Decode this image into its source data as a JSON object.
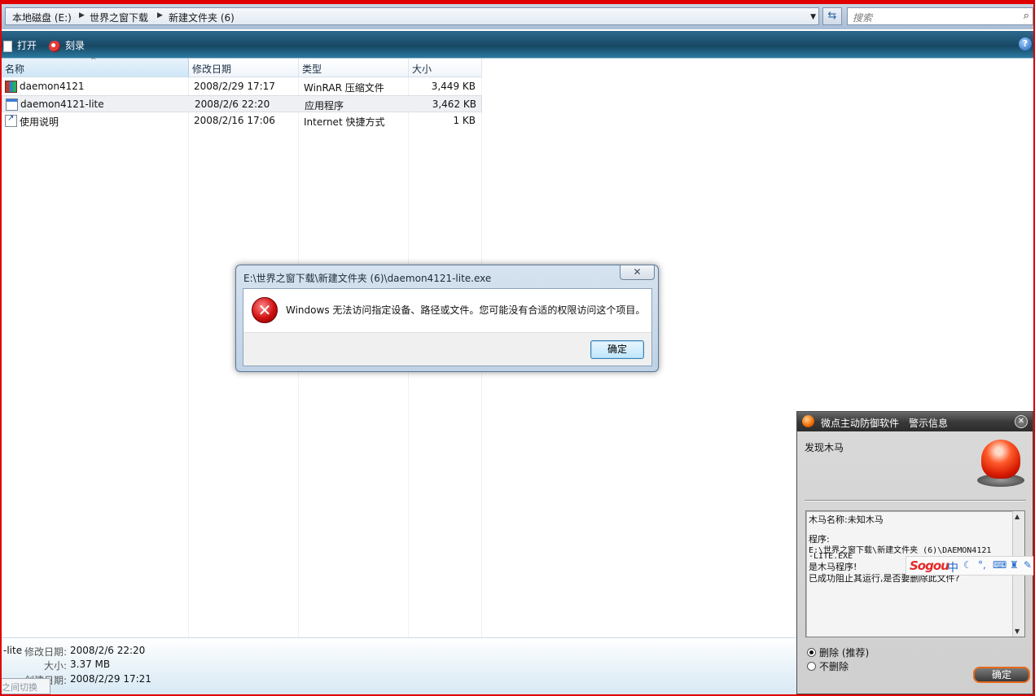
{
  "address_bar": {
    "crumbs": [
      "本地磁盘 (E:)",
      "世界之窗下载",
      "新建文件夹 (6)"
    ],
    "search_placeholder": "搜索"
  },
  "command_bar": {
    "open_label": "打开",
    "burn_label": "刻录"
  },
  "columns": {
    "name": "名称",
    "modified": "修改日期",
    "type": "类型",
    "size": "大小"
  },
  "files": [
    {
      "name": "daemon4121",
      "modified": "2008/2/29 17:17",
      "type": "WinRAR 压缩文件",
      "size": "3,449 KB",
      "icon": "winrar-archive-icon"
    },
    {
      "name": "daemon4121-lite",
      "modified": "2008/2/6 22:20",
      "type": "应用程序",
      "size": "3,462 KB",
      "icon": "application-exe-icon",
      "selected": true
    },
    {
      "name": "使用说明",
      "modified": "2008/2/16 17:06",
      "type": "Internet 快捷方式",
      "size": "1 KB",
      "icon": "internet-shortcut-icon"
    }
  ],
  "details": {
    "name_fragment": "-lite",
    "modified_label": "修改日期:",
    "modified_value": "2008/2/6 22:20",
    "size_label": "大小:",
    "size_value": "3.37 MB",
    "created_label": "创建日期:",
    "created_value": "2008/2/29 17:21",
    "tip_fragment": "之间切换"
  },
  "error_dialog": {
    "title": "E:\\世界之窗下载\\新建文件夹 (6)\\daemon4121-lite.exe",
    "message": "Windows 无法访问指定设备、路径或文件。您可能没有合适的权限访问这个项目。",
    "ok_label": "确定"
  },
  "security_alert": {
    "title": "微点主动防御软件　警示信息",
    "found_label": "发现木马",
    "trojan_name": "木马名称:未知木马",
    "program_label": "程序:",
    "program_path_1": "E:\\世界之窗下载\\新建文件夹 (6)\\DAEMON4121",
    "program_path_2": "-LITE.EXE",
    "is_trojan": "是木马程序!",
    "blocked_question": "已成功阻止其运行,是否要删除此文件?",
    "option_delete": "删除 (推荐)",
    "option_keep": "不删除",
    "ok_label": "确定",
    "accent_color": "#e86a1a"
  },
  "ime_toolbar": {
    "logo": "Sogou",
    "mode": "中"
  }
}
